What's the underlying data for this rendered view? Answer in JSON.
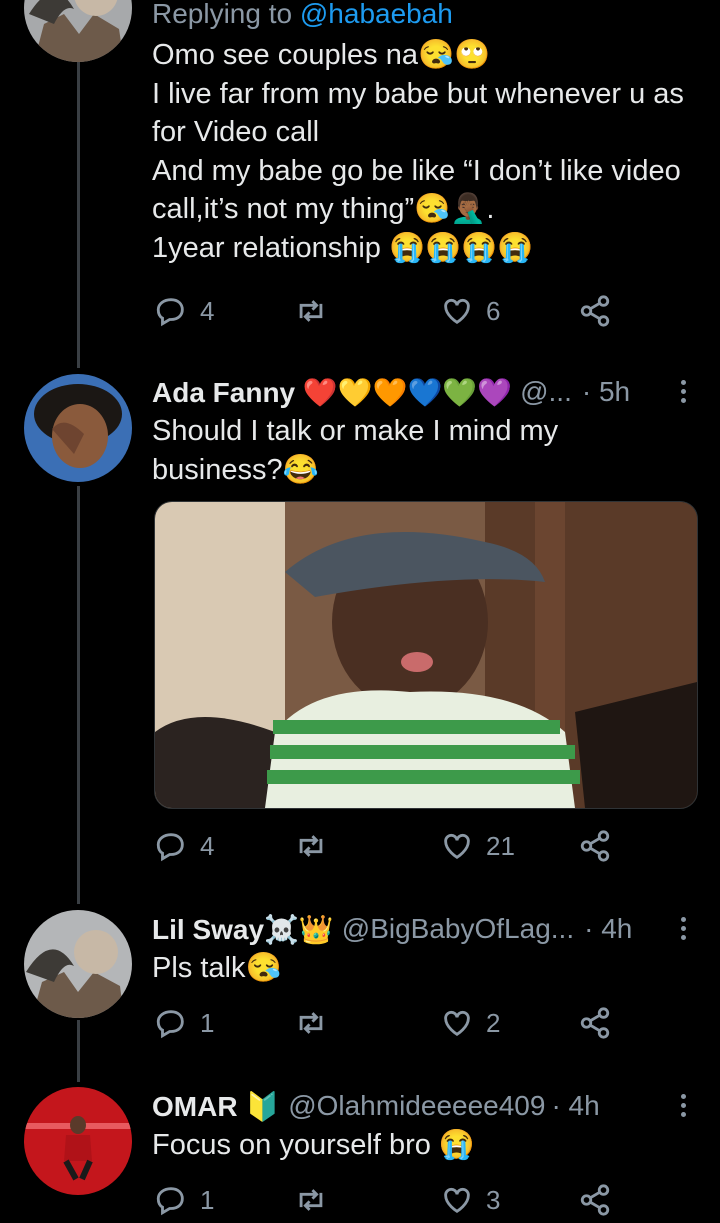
{
  "tweets": [
    {
      "reply_prefix": "Replying to",
      "reply_handle": "@habaebah",
      "lines": [
        "Omo see couples na😪🙄",
        "I live far from my babe but whenever u as",
        "for Video call",
        "And my babe go be like “I don’t like video",
        "call,it’s not my thing”😪🤦🏾‍♂️.",
        "1year relationship 😭😭😭😭"
      ],
      "replies": "4",
      "retweets": "",
      "likes": "6"
    },
    {
      "name": "Ada Fanny ❤️💛🧡💙💚💜",
      "handle": "@...",
      "time": "· 5h",
      "lines": [
        "Should I talk or make I mind my",
        "business?😂"
      ],
      "media_alt": "boy in striped shirt and cap",
      "replies": "4",
      "retweets": "",
      "likes": "21"
    },
    {
      "name": "Lil Sway☠️👑",
      "handle": "@BigBabyOfLag...",
      "time": "· 4h",
      "lines": [
        "Pls talk😪"
      ],
      "replies": "1",
      "retweets": "",
      "likes": "2"
    },
    {
      "name": "OMAR 🔰",
      "handle": "@Olahmideeeee409",
      "time": "· 4h",
      "lines": [
        "Focus on yourself bro 😭"
      ],
      "replies": "1",
      "retweets": "",
      "likes": "3"
    }
  ],
  "icons": {
    "reply": "reply-icon",
    "retweet": "retweet-icon",
    "like": "heart-icon",
    "share": "share-icon",
    "more": "more-icon"
  },
  "colors": {
    "background": "#000000",
    "text": "#e7e9ea",
    "muted": "#8b98a5",
    "link": "#1d9bf0",
    "thread_line": "#3a3f44"
  }
}
